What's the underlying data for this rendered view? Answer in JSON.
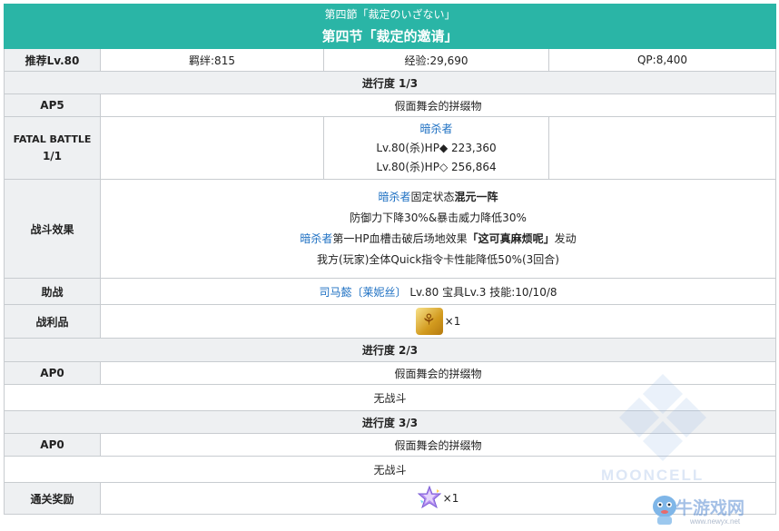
{
  "header": {
    "title_jp": "第四節「裁定のいざない」",
    "title_cn": "第四节「裁定的邀请」"
  },
  "info": {
    "recommend_label": "推荐Lv.80",
    "bond": "羁绊:815",
    "exp": "经验:29,690",
    "qp": "QP:8,400"
  },
  "progress1": {
    "title": "进行度 1/3",
    "ap_label": "AP5",
    "enemy_group": "假面舞会的拼缀物",
    "fatal_label": "FATAL BATTLE",
    "fatal_count": "1/1",
    "enemy_name": "暗杀者",
    "enemy_hp1": "Lv.80(杀)HP◆ 223,360",
    "enemy_hp2": "Lv.80(杀)HP◇ 256,864",
    "effect_label": "战斗效果",
    "effect1_name": "暗杀者",
    "effect1_mid": "固定状态",
    "effect1_bold": "混元一阵",
    "effect1_desc": "防御力下降30%&暴击威力降低30%",
    "effect2_name": "暗杀者",
    "effect2_mid": "第一HP血槽击破后场地效果",
    "effect2_bold": "「这可真麻烦呢」",
    "effect2_tail": "发动",
    "effect2_desc": "我方(玩家)全体Quick指令卡性能降低50%(3回合)",
    "support_label": "助战",
    "support_name": "司马懿〔莱妮丝〕",
    "support_detail": "Lv.80 宝具Lv.3 技能:10/10/8",
    "loot_label": "战利品",
    "loot_qty": "×1"
  },
  "progress2": {
    "title": "进行度 2/3",
    "ap_label": "AP0",
    "enemy_group": "假面舞会的拼缀物",
    "no_battle": "无战斗"
  },
  "progress3": {
    "title": "进行度 3/3",
    "ap_label": "AP0",
    "enemy_group": "假面舞会的拼缀物",
    "no_battle": "无战斗"
  },
  "reward": {
    "label": "通关奖励",
    "qty": "×1"
  },
  "watermark": {
    "mooncell": "MOONCELL",
    "site": "牛游戏网",
    "url": "www.newyx.net"
  },
  "colors": {
    "header": "#2ab5a6",
    "label_bg": "#eef0f2",
    "link": "#1c6fc2"
  }
}
